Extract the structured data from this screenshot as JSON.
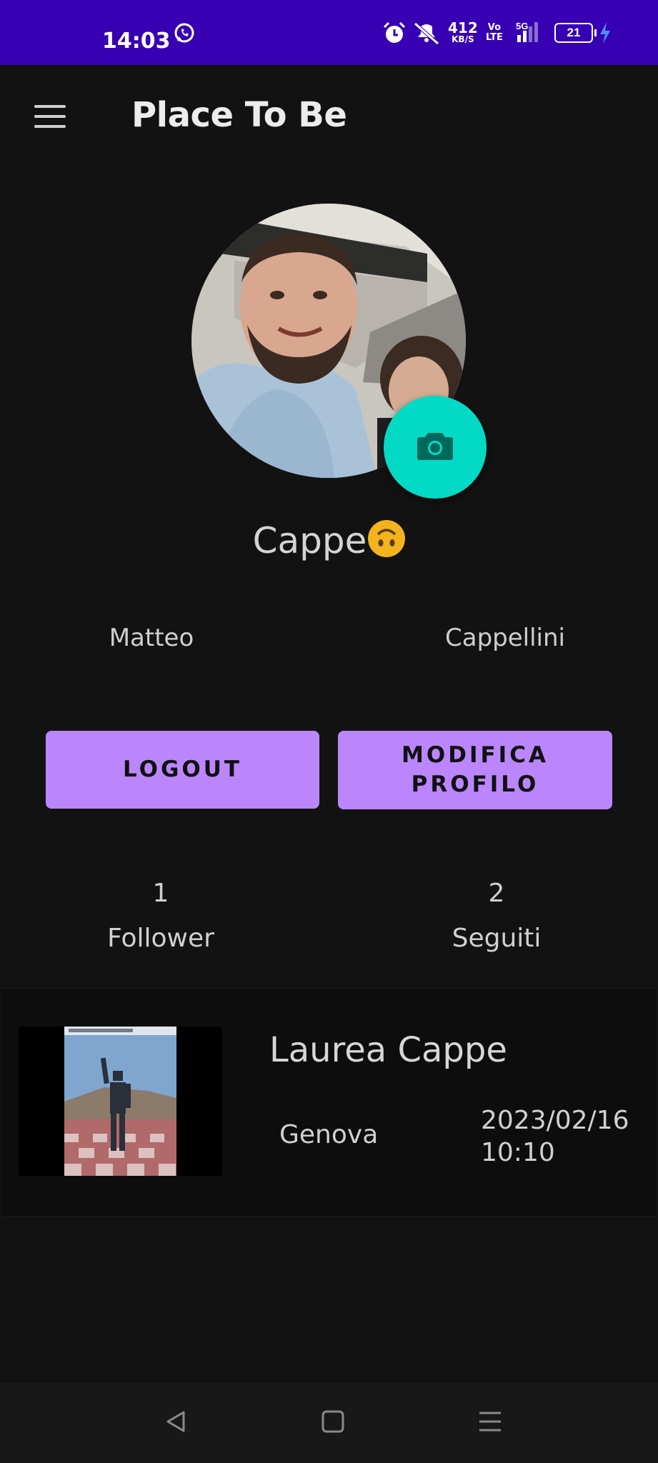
{
  "status_bar": {
    "time": "14:03",
    "net_speed_value": "412",
    "net_speed_unit": "KB/S",
    "volte_top": "Vo",
    "volte_bottom": "LTE",
    "network": "5G",
    "battery": "21"
  },
  "app_bar": {
    "title": "Place To Be"
  },
  "profile": {
    "nickname": "Cappe",
    "first_name": "Matteo",
    "last_name": "Cappellini"
  },
  "actions": {
    "logout_label": "LOGOUT",
    "edit_label_line1": "MODIFICA",
    "edit_label_line2": "PROFILO"
  },
  "stats": {
    "followers_count": "1",
    "followers_label": "Follower",
    "following_count": "2",
    "following_label": "Seguiti"
  },
  "events": [
    {
      "title": "Laurea Cappe",
      "place": "Genova",
      "date": "2023/02/16",
      "time": "10:10"
    }
  ],
  "colors": {
    "status_bar": "#3700b3",
    "background": "#121212",
    "button": "#bb86fc",
    "fab": "#03dac5"
  }
}
